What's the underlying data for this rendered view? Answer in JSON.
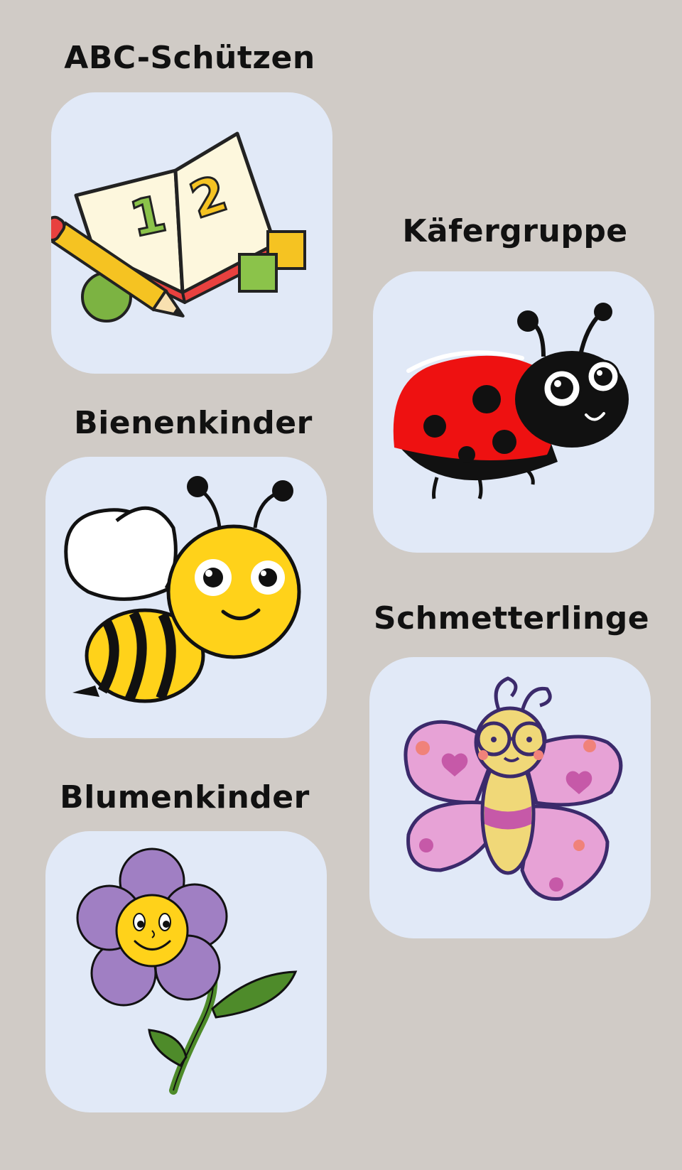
{
  "groups": {
    "abc": {
      "title": "ABC-Schützen",
      "icon": "book-numbers-icon"
    },
    "kaefer": {
      "title": "Käfergruppe",
      "icon": "ladybug-icon"
    },
    "bienen": {
      "title": "Bienenkinder",
      "icon": "bee-icon"
    },
    "schmetterlinge": {
      "title": "Schmetterlinge",
      "icon": "butterfly-icon"
    },
    "blumen": {
      "title": "Blumenkinder",
      "icon": "flower-icon"
    }
  },
  "book_digits": [
    "1",
    "2"
  ],
  "colors": {
    "background": "#d0cbc6",
    "tile": "#e1e9f7",
    "ladybug_red": "#ee1111",
    "bee_yellow": "#ffd21a",
    "flower_purple": "#a07fc3",
    "butterfly_pink": "#e7a2d6"
  }
}
